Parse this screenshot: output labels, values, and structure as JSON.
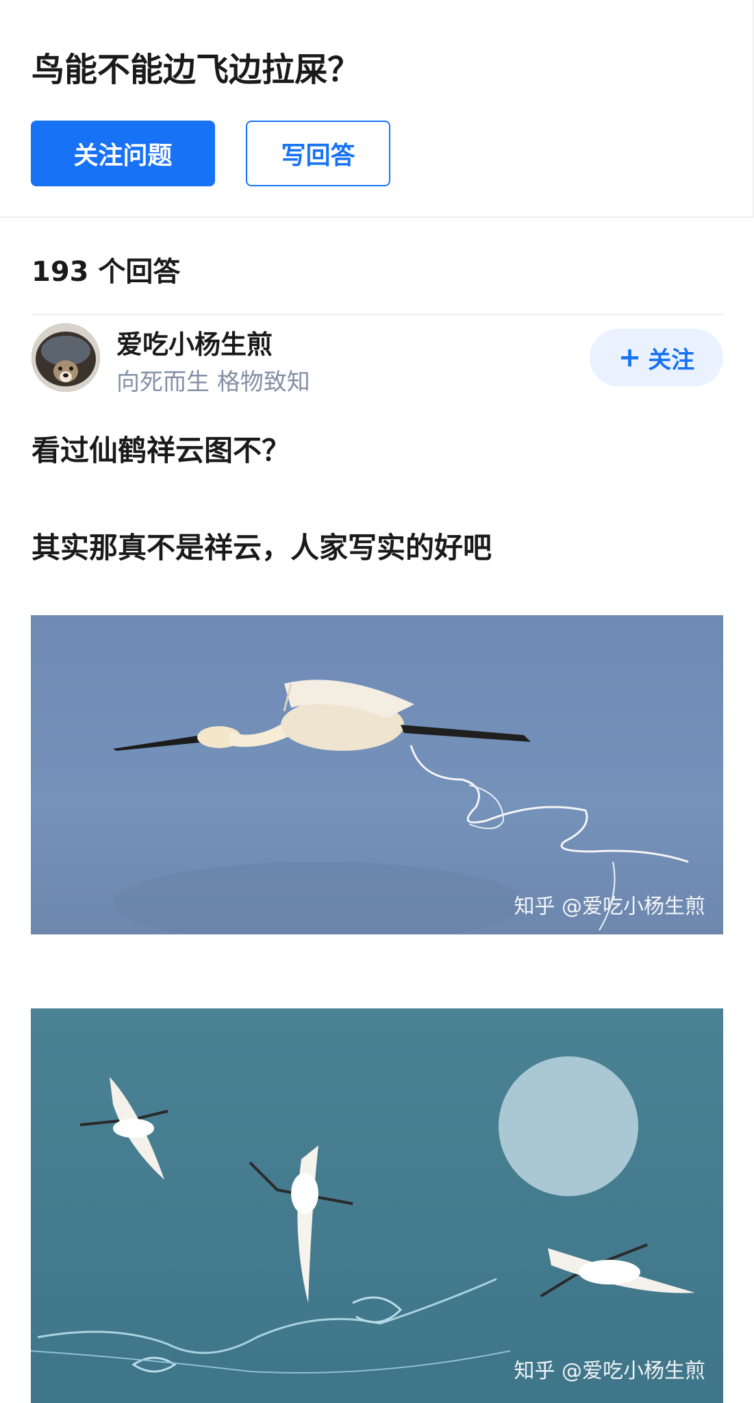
{
  "question": {
    "title": "鸟能不能边飞边拉屎？",
    "follow_label": "关注问题",
    "write_label": "写回答"
  },
  "answers": {
    "count_label": "193 个回答"
  },
  "answer": {
    "author": {
      "name": "爱吃小杨生煎",
      "bio": "向死而生 格物致知",
      "follow_label": "关注"
    },
    "paragraphs": [
      "看过仙鹤祥云图不？",
      "其实那真不是祥云，人家写实的好吧"
    ],
    "images": [
      {
        "watermark": "知乎 @爱吃小杨生煎"
      },
      {
        "watermark": "知乎 @爱吃小杨生煎"
      }
    ]
  },
  "colors": {
    "accent": "#1772f6",
    "follow_user_bg": "#eaf2ff",
    "muted_text": "#8590a6"
  }
}
